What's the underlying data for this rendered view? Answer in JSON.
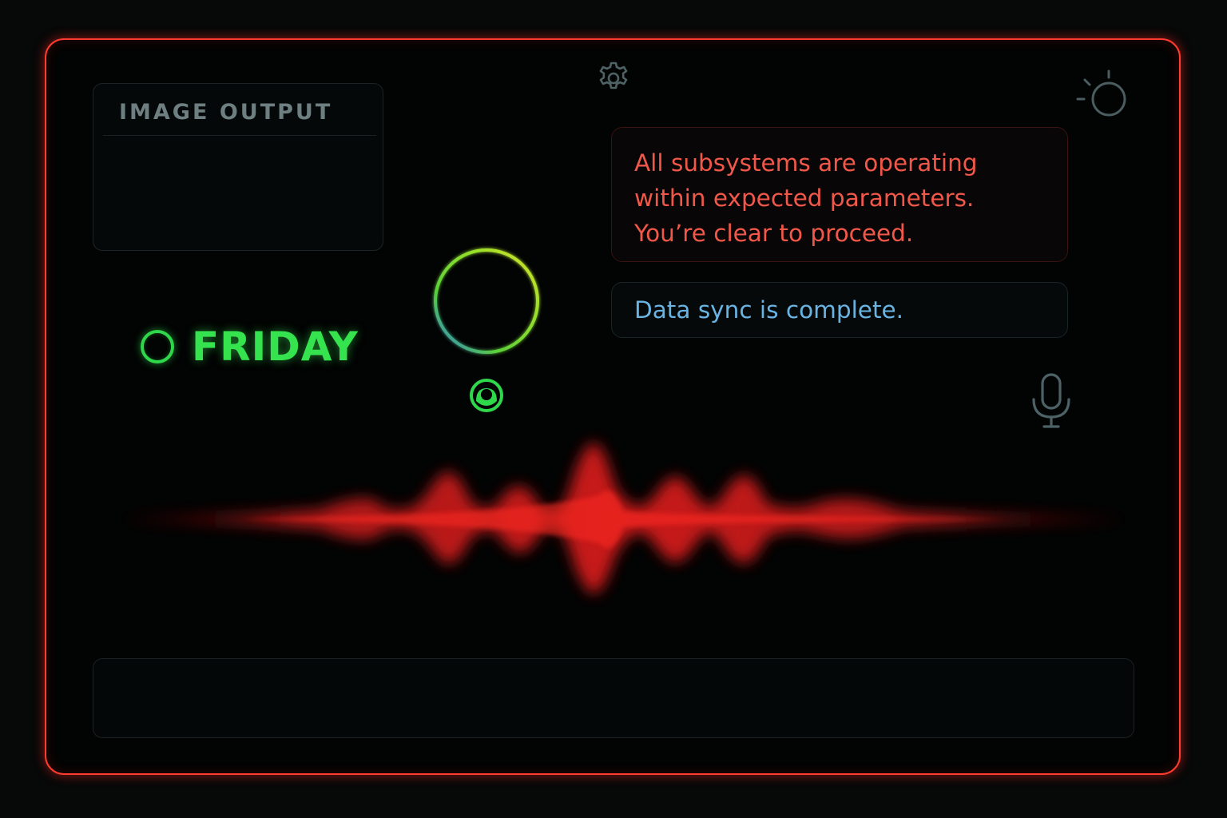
{
  "image_panel": {
    "title": "IMAGE OUTPUT"
  },
  "assistant": {
    "name": "FRIDAY"
  },
  "messages": {
    "status": "All subsystems are operating within expected parameters. You’re clear to proceed.",
    "sync": "Data sync is complete."
  },
  "icons": {
    "settings": "gear-icon",
    "theme": "brightness-icon",
    "mic": "microphone-icon",
    "headset": "headset-icon",
    "status_ring": "ring-icon"
  },
  "input": {
    "value": ""
  },
  "colors": {
    "frame": "#ff3b30",
    "assistant": "#35e34f",
    "status_text": "#f2584a",
    "sync_text": "#6ab4e4",
    "waveform": "#e01e1e"
  }
}
